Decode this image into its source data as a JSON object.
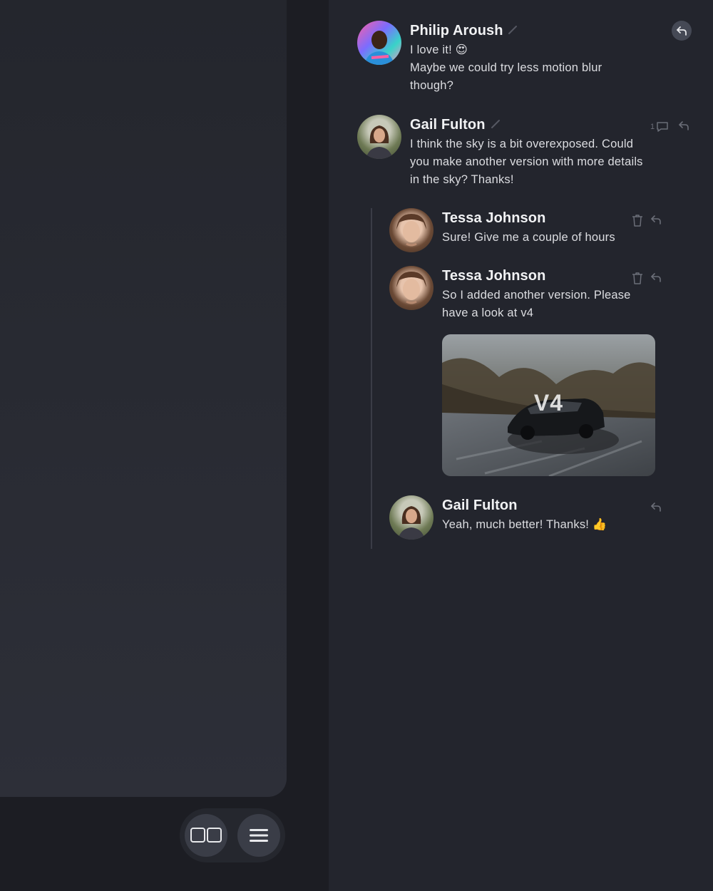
{
  "toolbar": {
    "split_view_icon": "split-view-icon",
    "menu_icon": "hamburger-menu-icon"
  },
  "comments": [
    {
      "author": "Philip Aroush",
      "lines": [
        "I love it! 😍",
        "Maybe we could try less motion blur",
        "though?"
      ],
      "reply_icon": "reply-arrow-icon"
    },
    {
      "author": "Gail Fulton",
      "lines": [
        "I think the sky is a bit overexposed. Could",
        "you make another version with more details",
        "in the sky? Thanks!"
      ],
      "reply_count": "1",
      "reply_icon": "reply-arrow-icon"
    }
  ],
  "replies": [
    {
      "author": "Tessa Johnson",
      "lines": [
        "Sure! Give me a couple of hours"
      ]
    },
    {
      "author": "Tessa Johnson",
      "lines": [
        "So I added another version. Please",
        "have a look at v4"
      ],
      "attachment_label": "V4"
    },
    {
      "author": "Gail Fulton",
      "lines": [
        "Yeah, much better! Thanks! 👍"
      ]
    }
  ],
  "colors": {
    "page_bg": "#1c1d23",
    "panel_bg": "#23252d",
    "text": "#dcdde1",
    "muted_icon": "#6b6e78"
  }
}
